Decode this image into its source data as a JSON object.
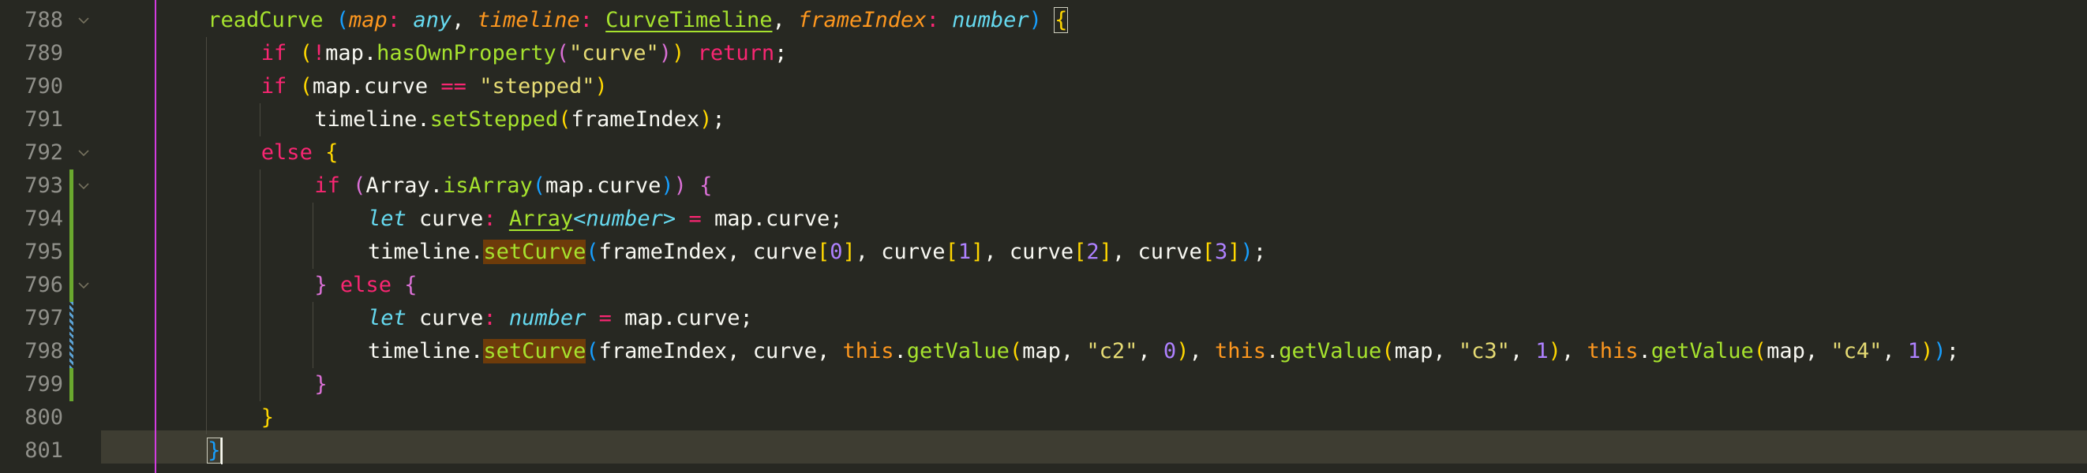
{
  "gutter": {
    "line_numbers": [
      "788",
      "789",
      "790",
      "791",
      "792",
      "793",
      "794",
      "795",
      "796",
      "797",
      "798",
      "799",
      "800",
      "801"
    ],
    "folds": [
      "788",
      "792",
      "793",
      "796"
    ]
  },
  "colors": {
    "background": "#272822",
    "line_highlight": "#3e3d32",
    "git_modified": "#6aa82e",
    "git_added": "#5ca3d6",
    "ruler": "#d33ce0"
  },
  "code": {
    "lines": [
      {
        "indent": 2,
        "tokens": [
          {
            "t": "readCurve ",
            "c": "fn"
          },
          {
            "t": "(",
            "c": "p3"
          },
          {
            "t": "map",
            "c": "par"
          },
          {
            "t": ": ",
            "c": "op"
          },
          {
            "t": "any",
            "c": "ty"
          },
          {
            "t": ", "
          },
          {
            "t": "timeline",
            "c": "par"
          },
          {
            "t": ": ",
            "c": "op"
          },
          {
            "t": "CurveTimeline",
            "c": "cls"
          },
          {
            "t": ", "
          },
          {
            "t": "frameIndex",
            "c": "par"
          },
          {
            "t": ": ",
            "c": "op"
          },
          {
            "t": "number",
            "c": "ty"
          },
          {
            "t": ")",
            "c": "p3"
          },
          {
            "t": " "
          },
          {
            "t": "{",
            "c": "p1 match"
          }
        ]
      },
      {
        "indent": 3,
        "tokens": [
          {
            "t": "if ",
            "c": "kw"
          },
          {
            "t": "(",
            "c": "p1"
          },
          {
            "t": "!",
            "c": "op"
          },
          {
            "t": "map."
          },
          {
            "t": "hasOwnProperty",
            "c": "fn"
          },
          {
            "t": "(",
            "c": "p2"
          },
          {
            "t": "\"curve\"",
            "c": "str"
          },
          {
            "t": ")",
            "c": "p2"
          },
          {
            "t": ")",
            "c": "p1"
          },
          {
            "t": " "
          },
          {
            "t": "return",
            "c": "kw"
          },
          {
            "t": ";"
          }
        ]
      },
      {
        "indent": 3,
        "tokens": [
          {
            "t": "if ",
            "c": "kw"
          },
          {
            "t": "(",
            "c": "p1"
          },
          {
            "t": "map.curve "
          },
          {
            "t": "==",
            "c": "op"
          },
          {
            "t": " "
          },
          {
            "t": "\"stepped\"",
            "c": "str"
          },
          {
            "t": ")",
            "c": "p1"
          }
        ]
      },
      {
        "indent": 4,
        "tokens": [
          {
            "t": "timeline."
          },
          {
            "t": "setStepped",
            "c": "fn"
          },
          {
            "t": "(",
            "c": "p1"
          },
          {
            "t": "frameIndex"
          },
          {
            "t": ")",
            "c": "p1"
          },
          {
            "t": ";"
          }
        ]
      },
      {
        "indent": 3,
        "tokens": [
          {
            "t": "else ",
            "c": "kw"
          },
          {
            "t": "{",
            "c": "p1"
          }
        ]
      },
      {
        "indent": 4,
        "tokens": [
          {
            "t": "if ",
            "c": "kw"
          },
          {
            "t": "(",
            "c": "p2"
          },
          {
            "t": "Array."
          },
          {
            "t": "isArray",
            "c": "fn"
          },
          {
            "t": "(",
            "c": "p3"
          },
          {
            "t": "map.curve"
          },
          {
            "t": ")",
            "c": "p3"
          },
          {
            "t": ")",
            "c": "p2"
          },
          {
            "t": " "
          },
          {
            "t": "{",
            "c": "p2"
          }
        ]
      },
      {
        "indent": 5,
        "tokens": [
          {
            "t": "let ",
            "c": "ty"
          },
          {
            "t": "curve"
          },
          {
            "t": ": ",
            "c": "op"
          },
          {
            "t": "Array",
            "c": "cls"
          },
          {
            "t": "<",
            "c": "ty"
          },
          {
            "t": "number",
            "c": "ty"
          },
          {
            "t": ">",
            "c": "ty"
          },
          {
            "t": " "
          },
          {
            "t": "=",
            "c": "op"
          },
          {
            "t": " map.curve;"
          }
        ]
      },
      {
        "indent": 5,
        "tokens": [
          {
            "t": "timeline."
          },
          {
            "t": "setCurve",
            "c": "fn ref"
          },
          {
            "t": "(",
            "c": "p3"
          },
          {
            "t": "frameIndex, curve"
          },
          {
            "t": "[",
            "c": "p1"
          },
          {
            "t": "0",
            "c": "num"
          },
          {
            "t": "]",
            "c": "p1"
          },
          {
            "t": ", curve"
          },
          {
            "t": "[",
            "c": "p1"
          },
          {
            "t": "1",
            "c": "num"
          },
          {
            "t": "]",
            "c": "p1"
          },
          {
            "t": ", curve"
          },
          {
            "t": "[",
            "c": "p1"
          },
          {
            "t": "2",
            "c": "num"
          },
          {
            "t": "]",
            "c": "p1"
          },
          {
            "t": ", curve"
          },
          {
            "t": "[",
            "c": "p1"
          },
          {
            "t": "3",
            "c": "num"
          },
          {
            "t": "]",
            "c": "p1"
          },
          {
            "t": ")",
            "c": "p3"
          },
          {
            "t": ";"
          }
        ]
      },
      {
        "indent": 4,
        "tokens": [
          {
            "t": "}",
            "c": "p2"
          },
          {
            "t": " "
          },
          {
            "t": "else ",
            "c": "kw"
          },
          {
            "t": "{",
            "c": "p2"
          }
        ]
      },
      {
        "indent": 5,
        "tokens": [
          {
            "t": "let ",
            "c": "ty"
          },
          {
            "t": "curve"
          },
          {
            "t": ": ",
            "c": "op"
          },
          {
            "t": "number",
            "c": "ty"
          },
          {
            "t": " "
          },
          {
            "t": "=",
            "c": "op"
          },
          {
            "t": " map.curve;"
          }
        ]
      },
      {
        "indent": 5,
        "tokens": [
          {
            "t": "timeline."
          },
          {
            "t": "setCurve",
            "c": "fn ref"
          },
          {
            "t": "(",
            "c": "p3"
          },
          {
            "t": "frameIndex, curve, "
          },
          {
            "t": "this",
            "c": "thisk"
          },
          {
            "t": "."
          },
          {
            "t": "getValue",
            "c": "fn"
          },
          {
            "t": "(",
            "c": "p1"
          },
          {
            "t": "map, "
          },
          {
            "t": "\"c2\"",
            "c": "str"
          },
          {
            "t": ", "
          },
          {
            "t": "0",
            "c": "num"
          },
          {
            "t": ")",
            "c": "p1"
          },
          {
            "t": ", "
          },
          {
            "t": "this",
            "c": "thisk"
          },
          {
            "t": "."
          },
          {
            "t": "getValue",
            "c": "fn"
          },
          {
            "t": "(",
            "c": "p1"
          },
          {
            "t": "map, "
          },
          {
            "t": "\"c3\"",
            "c": "str"
          },
          {
            "t": ", "
          },
          {
            "t": "1",
            "c": "num"
          },
          {
            "t": ")",
            "c": "p1"
          },
          {
            "t": ", "
          },
          {
            "t": "this",
            "c": "thisk"
          },
          {
            "t": "."
          },
          {
            "t": "getValue",
            "c": "fn"
          },
          {
            "t": "(",
            "c": "p1"
          },
          {
            "t": "map, "
          },
          {
            "t": "\"c4\"",
            "c": "str"
          },
          {
            "t": ", "
          },
          {
            "t": "1",
            "c": "num"
          },
          {
            "t": ")",
            "c": "p1"
          },
          {
            "t": ")",
            "c": "p3"
          },
          {
            "t": ";"
          }
        ]
      },
      {
        "indent": 4,
        "tokens": [
          {
            "t": "}",
            "c": "p2"
          }
        ]
      },
      {
        "indent": 3,
        "tokens": [
          {
            "t": "}",
            "c": "p1"
          }
        ]
      },
      {
        "indent": 2,
        "tokens": [
          {
            "t": "}",
            "c": "p3 match"
          }
        ]
      }
    ]
  }
}
